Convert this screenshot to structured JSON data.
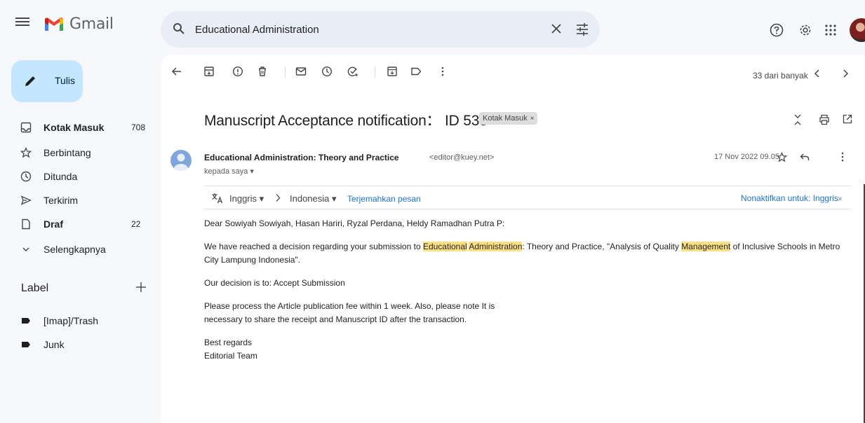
{
  "app": {
    "logo_text": "Gmail"
  },
  "search": {
    "value": "Educational Administration",
    "placeholder": ""
  },
  "compose": {
    "label": "Tulis"
  },
  "nav": [
    {
      "label": "Kotak Masuk",
      "count": "708",
      "icon": "inbox-icon",
      "bold": true
    },
    {
      "label": "Berbintang",
      "count": "",
      "icon": "star-icon"
    },
    {
      "label": "Ditunda",
      "count": "",
      "icon": "clock-icon"
    },
    {
      "label": "Terkirim",
      "count": "",
      "icon": "send-icon"
    },
    {
      "label": "Draf",
      "count": "22",
      "icon": "draft-icon",
      "bold": true
    },
    {
      "label": "Selengkapnya",
      "count": "",
      "icon": "chevron-down-icon"
    }
  ],
  "labels": {
    "heading": "Label",
    "items": [
      {
        "label": "[Imap]/Trash",
        "icon": "label-icon"
      },
      {
        "label": "Junk",
        "icon": "label-icon"
      }
    ]
  },
  "toolbar": {
    "pager_text": "33 dari banyak"
  },
  "message": {
    "subject": "Manuscript Acceptance notification：  ID 533",
    "inbox_chip": "Kotak Masuk",
    "chip_close": "×",
    "sender_name": "Educational Administration: Theory and Practice",
    "sender_email": "<editor@kuey.net>",
    "recipient": "kepada saya ▾",
    "date": "17 Nov 2022 09.05",
    "translate": {
      "from": "Inggris ▾",
      "to": "Indonesia ▾",
      "link": "Terjemahkan pesan",
      "off": "Nonaktifkan untuk: Inggris",
      "close": "×"
    },
    "greeting": "Dear Sowiyah Sowiyah, Hasan Hariri, Ryzal Perdana, Heldy Ramadhan Putra P:",
    "para1": {
      "t1": "We have reached a decision regarding your submission to ",
      "hl1": "Educational",
      "t2": " ",
      "hl2": "Administration",
      "t3": ": Theory and Practice, \"Analysis of Quality ",
      "hl3": "Management",
      "t4": " of Inclusive Schools in Metro City Lampung Indonesia\"."
    },
    "para2": "Our decision is to: Accept Submission",
    "para3_line1": "Please process the Article publication fee within 1 week. Also, please note It is",
    "para3_line2": "necessary to share the receipt and Manuscript ID after the transaction.",
    "closing1": "Best regards",
    "closing2": "Editorial Team"
  },
  "colors": {
    "accent": "#c2e7ff",
    "highlight": "#ffe082",
    "link": "#1a73e8"
  }
}
